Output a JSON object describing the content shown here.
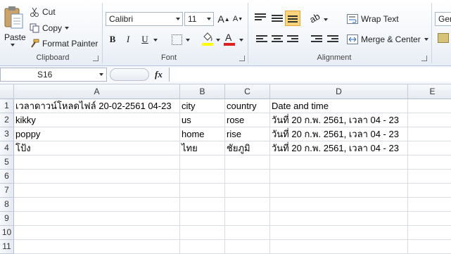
{
  "ribbon": {
    "clipboard": {
      "paste_label": "Paste",
      "cut_label": "Cut",
      "copy_label": "Copy",
      "format_painter_label": "Format Painter",
      "group_label": "Clipboard"
    },
    "font": {
      "font_name": "Calibri",
      "font_size": "11",
      "bold": "B",
      "italic": "I",
      "underline": "U",
      "group_label": "Font",
      "fill_color": "#ffff00",
      "font_color": "#e02020"
    },
    "alignment": {
      "wrap_text_label": "Wrap Text",
      "merge_center_label": "Merge & Center",
      "group_label": "Alignment"
    },
    "number": {
      "format_value": "Gen"
    }
  },
  "formula_bar": {
    "name_box": "S16",
    "fx_label": "fx",
    "formula": ""
  },
  "sheet": {
    "columns": [
      "A",
      "B",
      "C",
      "D",
      "E"
    ],
    "row_numbers": [
      "1",
      "2",
      "3",
      "4",
      "5",
      "6",
      "7",
      "8",
      "9",
      "10",
      "11"
    ],
    "rows": [
      [
        "เวลาดาวน์โหลดไฟล์ 20-02-2561 04-23",
        "city",
        "country",
        "Date and time",
        ""
      ],
      [
        "kikky",
        "us",
        "rose",
        "วันที่ 20 ก.พ. 2561, เวลา  04 - 23",
        ""
      ],
      [
        "poppy",
        "home",
        "rise",
        "วันที่ 20 ก.พ. 2561, เวลา  04 - 23",
        ""
      ],
      [
        "โป้ง",
        "ไทย",
        "ชัยภูมิ",
        "วันที่ 20 ก.พ. 2561, เวลา  04 - 23",
        ""
      ]
    ]
  }
}
